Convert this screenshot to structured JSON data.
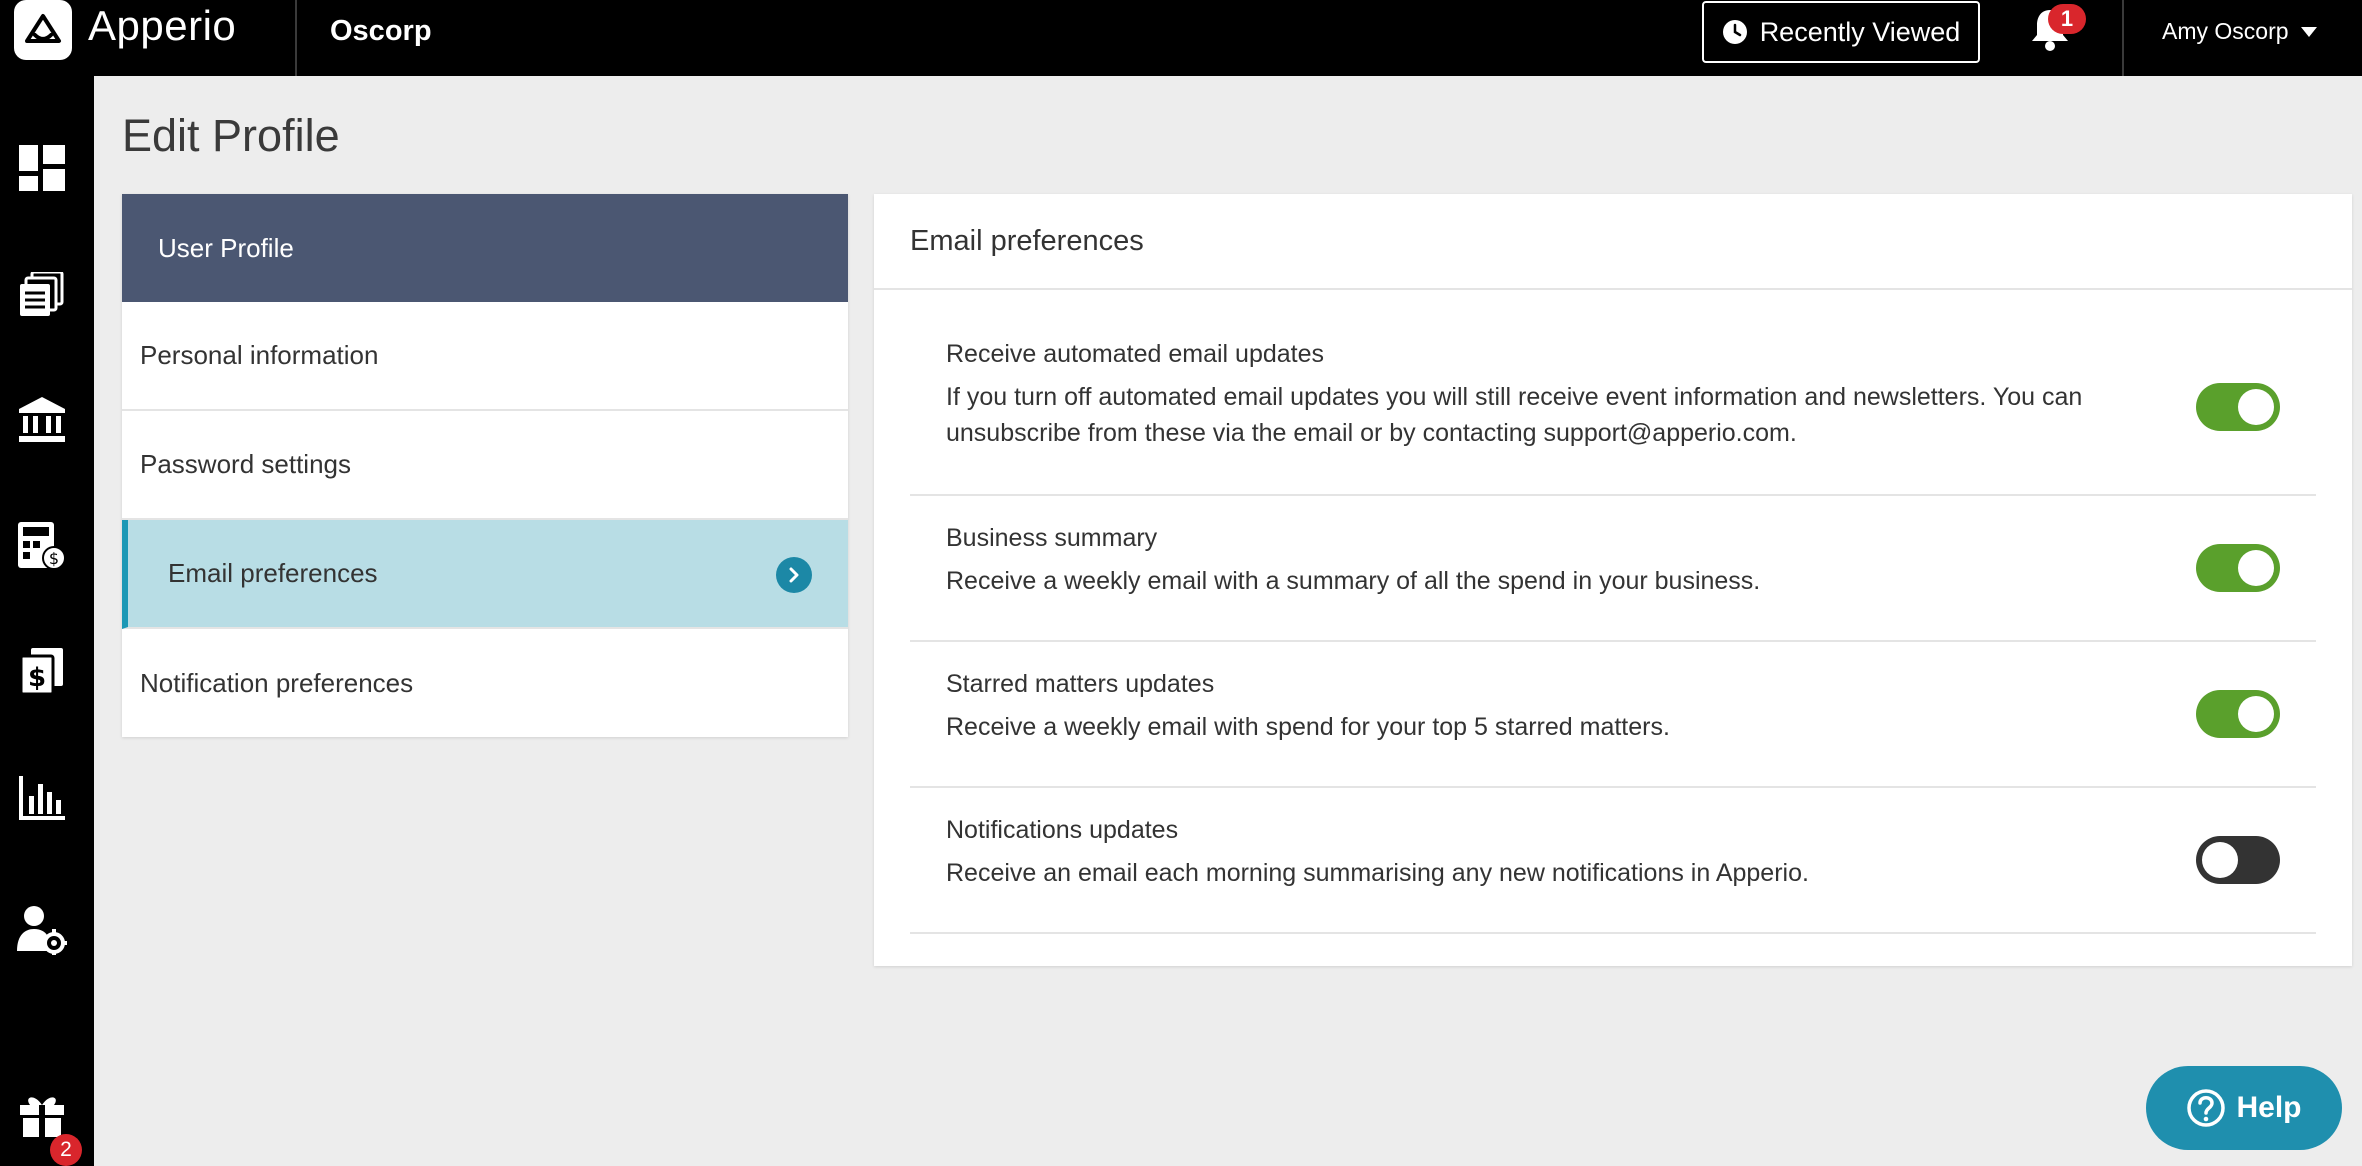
{
  "header": {
    "brand": "Apperio",
    "org": "Oscorp",
    "recently_viewed": "Recently Viewed",
    "notification_count": "1",
    "user_name": "Amy Oscorp"
  },
  "sidebar": {
    "items": [
      {
        "icon": "dashboard-icon"
      },
      {
        "icon": "documents-icon"
      },
      {
        "icon": "bank-icon"
      },
      {
        "icon": "calculator-icon"
      },
      {
        "icon": "invoice-icon"
      },
      {
        "icon": "chart-icon"
      },
      {
        "icon": "user-settings-icon"
      },
      {
        "icon": "gift-icon"
      }
    ],
    "gift_badge": "2"
  },
  "page": {
    "title": "Edit Profile"
  },
  "profile_menu": {
    "header": "User Profile",
    "items": [
      {
        "label": "Personal information",
        "active": false
      },
      {
        "label": "Password settings",
        "active": false
      },
      {
        "label": "Email preferences",
        "active": true
      },
      {
        "label": "Notification preferences",
        "active": false
      }
    ]
  },
  "email_preferences": {
    "title": "Email preferences",
    "items": [
      {
        "title": "Receive automated email updates",
        "description": "If you turn off automated email updates you will still receive event information and newsletters. You can unsubscribe from these via the email or by contacting support@apperio.com.",
        "enabled": true
      },
      {
        "title": "Business summary",
        "description": "Receive a weekly email with a summary of all the spend in your business.",
        "enabled": true
      },
      {
        "title": "Starred matters updates",
        "description": "Receive a weekly email with spend for your top 5 starred matters.",
        "enabled": true
      },
      {
        "title": "Notifications updates",
        "description": "Receive an email each morning summarising any new notifications in Apperio.",
        "enabled": false
      }
    ]
  },
  "help": {
    "label": "Help"
  },
  "colors": {
    "topbar": "#000000",
    "menu_header": "#4b5772",
    "active_item": "#b8dde5",
    "accent": "#1b98b5",
    "toggle_on": "#5aa02c",
    "toggle_off": "#333333",
    "badge": "#d9262c"
  }
}
